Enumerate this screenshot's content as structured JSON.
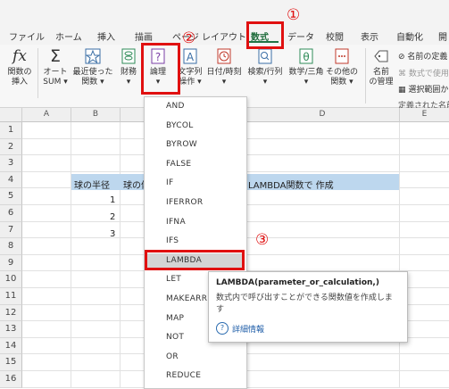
{
  "tabs": [
    "ファイル",
    "ホーム",
    "挿入",
    "描画",
    "ページ レイアウト",
    "数式",
    "データ",
    "校閲",
    "表示",
    "自動化",
    "開"
  ],
  "ribbon": {
    "insert_function": [
      "関数の",
      "挿入"
    ],
    "autosum": [
      "オート",
      "SUM ▾"
    ],
    "recent": [
      "最近使った",
      "関数 ▾"
    ],
    "financial": [
      "財務",
      "▾"
    ],
    "logical": [
      "論理",
      "▾"
    ],
    "text": [
      "文字列",
      "操作 ▾"
    ],
    "datetime": [
      "日付/時刻",
      "▾"
    ],
    "lookup": [
      "検索/行列",
      "▾"
    ],
    "math": [
      "数学/三角",
      "▾"
    ],
    "more": [
      "その他の",
      "関数 ▾"
    ],
    "name_manager": [
      "名前",
      "の管理"
    ],
    "define_name": "名前の定義",
    "use_in_formula": "数式で使用",
    "create_from_selection": "選択範囲から",
    "defined_names_group": "定義された名前"
  },
  "grid": {
    "columns": [
      "A",
      "B",
      "D",
      "E"
    ],
    "rows": [
      "1",
      "2",
      "3",
      "4",
      "5",
      "6",
      "7",
      "8",
      "9",
      "10",
      "11",
      "12",
      "13",
      "14",
      "15",
      "16"
    ],
    "b4": "球の半径",
    "c4": "球の体",
    "d4": "LAMBDA関数で 作成",
    "b5": "1",
    "b6": "2",
    "b7": "3",
    "highlight_color": "#bdd7ee"
  },
  "dropdown": {
    "items": [
      "AND",
      "BYCOL",
      "BYROW",
      "FALSE",
      "IF",
      "IFERROR",
      "IFNA",
      "IFS",
      "LAMBDA",
      "LET",
      "MAKEARR",
      "MAP",
      "NOT",
      "OR",
      "REDUCE"
    ],
    "selected": "LAMBDA"
  },
  "tooltip": {
    "signature": "LAMBDA(parameter_or_calculation,)",
    "description": "数式内で呼び出すことができる関数値を作成しま す",
    "link": "詳細情報"
  },
  "markers": [
    "①",
    "②",
    "③"
  ],
  "colors": {
    "accent": "#e01010",
    "excel_green": "#217346"
  }
}
